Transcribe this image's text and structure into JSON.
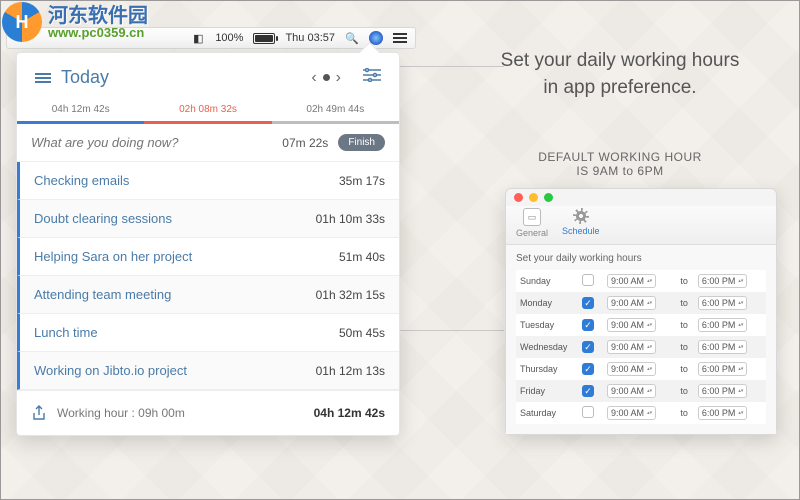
{
  "watermark": {
    "cn": "河东软件园",
    "url": "www.pc0359.cn"
  },
  "menubar": {
    "battery_pct": "100%",
    "clock": "Thu 03:57"
  },
  "tracker": {
    "title": "Today",
    "segments": [
      {
        "label": "04h 12m 42s",
        "cls": "blue"
      },
      {
        "label": "02h 08m 32s",
        "cls": "red"
      },
      {
        "label": "02h 49m 44s",
        "cls": "gray"
      }
    ],
    "input_placeholder": "What are you doing now?",
    "current_duration": "07m 22s",
    "finish_label": "Finish",
    "tasks": [
      {
        "name": "Checking emails",
        "dur": "35m 17s"
      },
      {
        "name": "Doubt clearing sessions",
        "dur": "01h 10m 33s"
      },
      {
        "name": "Helping Sara on her project",
        "dur": "51m 40s"
      },
      {
        "name": "Attending team meeting",
        "dur": "01h 32m 15s"
      },
      {
        "name": "Lunch time",
        "dur": "50m 45s"
      },
      {
        "name": "Working on Jibto.io project",
        "dur": "01h 12m 13s"
      }
    ],
    "working_hour_label": "Working hour : 09h 00m",
    "total": "04h 12m 42s"
  },
  "headline": {
    "l1": "Set your daily working hours",
    "l2": "in app preference."
  },
  "subhead": {
    "l1": "DEFAULT WORKING HOUR",
    "l2": "IS 9AM to 6PM"
  },
  "pref": {
    "tabs": {
      "general": "General",
      "schedule": "Schedule"
    },
    "label": "Set your daily working hours",
    "to": "to",
    "rows": [
      {
        "day": "Sunday",
        "on": false,
        "from": "9:00 AM",
        "to": "6:00 PM"
      },
      {
        "day": "Monday",
        "on": true,
        "from": "9:00 AM",
        "to": "6:00 PM"
      },
      {
        "day": "Tuesday",
        "on": true,
        "from": "9:00 AM",
        "to": "6:00 PM"
      },
      {
        "day": "Wednesday",
        "on": true,
        "from": "9:00 AM",
        "to": "6:00 PM"
      },
      {
        "day": "Thursday",
        "on": true,
        "from": "9:00 AM",
        "to": "6:00 PM"
      },
      {
        "day": "Friday",
        "on": true,
        "from": "9:00 AM",
        "to": "6:00 PM"
      },
      {
        "day": "Saturday",
        "on": false,
        "from": "9:00 AM",
        "to": "6:00 PM"
      }
    ]
  }
}
